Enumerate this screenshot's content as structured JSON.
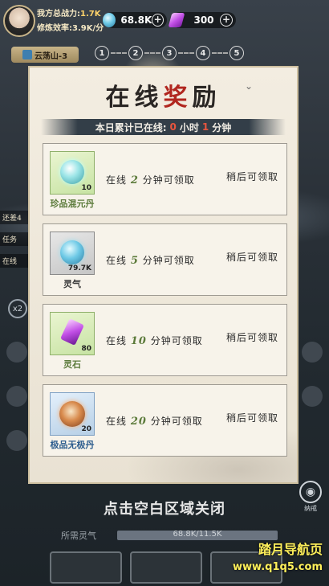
{
  "player": {
    "power_label": "我方总战力:",
    "power_value": "1.7K",
    "efficiency_label": "修炼效率:",
    "efficiency_value": "3.9K/分"
  },
  "resources": {
    "qi": {
      "icon": "qi-orb-icon",
      "value": "68.8K"
    },
    "stone": {
      "icon": "spirit-stone-icon",
      "value": "300"
    }
  },
  "stage": {
    "name": "云荡山-3",
    "steps": [
      "1",
      "2",
      "3",
      "4",
      "5"
    ]
  },
  "left_side": {
    "chip1": "还差4",
    "chip2": "任务",
    "chip3": "在线",
    "speed": "x2"
  },
  "modal": {
    "title_part1": "在线",
    "title_part2": "奖",
    "title_part3": "励",
    "online_prefix": "本日累计已在线:",
    "hours": "0",
    "hours_unit": "小时",
    "minutes": "1",
    "minutes_unit": "分钟",
    "rewards": [
      {
        "name": "珍品混元丹",
        "qty": "10",
        "req_prefix": "在线",
        "req_num": "2",
        "req_suffix": "分钟可领取",
        "status": "稍后可领取",
        "icon": "hunyuan-pill-icon",
        "rarity": "green"
      },
      {
        "name": "灵气",
        "qty": "79.7K",
        "req_prefix": "在线",
        "req_num": "5",
        "req_suffix": "分钟可领取",
        "status": "稍后可领取",
        "icon": "qi-orb-icon",
        "rarity": "white"
      },
      {
        "name": "灵石",
        "qty": "80",
        "req_prefix": "在线",
        "req_num": "10",
        "req_suffix": "分钟可领取",
        "status": "稍后可领取",
        "icon": "spirit-stone-icon",
        "rarity": "green"
      },
      {
        "name": "极品无极丹",
        "qty": "20",
        "req_prefix": "在线",
        "req_num": "20",
        "req_suffix": "分钟可领取",
        "status": "稍后可领取",
        "icon": "wuji-pill-icon",
        "rarity": "blue"
      }
    ]
  },
  "footer": {
    "close_hint": "点击空白区域关闭",
    "required_qi_label": "所需灵气",
    "required_qi_value": "68.8K/11.5K",
    "required_qi_progress": 1.0,
    "right_button_label": "纳戒"
  },
  "watermark": {
    "line1": "踏月导航页",
    "line2": "www.q1q5.com"
  }
}
